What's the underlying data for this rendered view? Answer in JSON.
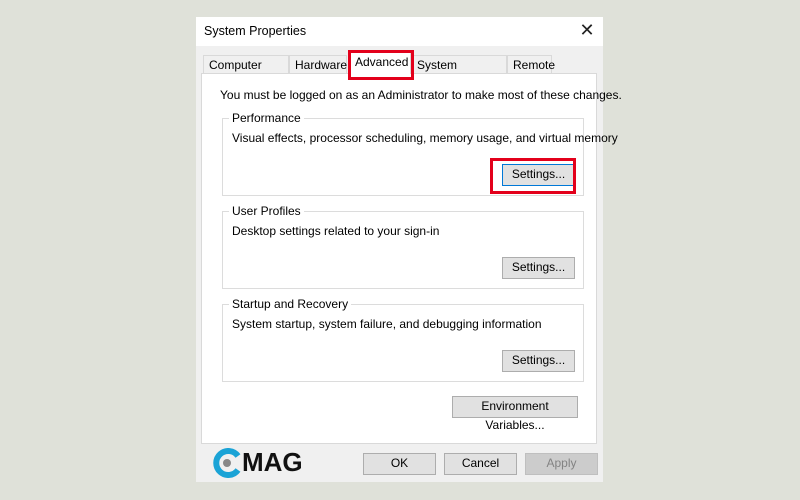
{
  "window": {
    "title": "System Properties",
    "close_icon": "close-icon"
  },
  "tabs": [
    {
      "label": "Computer Name"
    },
    {
      "label": "Hardware"
    },
    {
      "label": "Advanced",
      "active": true
    },
    {
      "label": "System Protection"
    },
    {
      "label": "Remote"
    }
  ],
  "notice": "You must be logged on as an Administrator to make most of these changes.",
  "groups": [
    {
      "title": "Performance",
      "description": "Visual effects, processor scheduling, memory usage, and virtual memory",
      "button": "Settings..."
    },
    {
      "title": "User Profiles",
      "description": "Desktop settings related to your sign-in",
      "button": "Settings..."
    },
    {
      "title": "Startup and Recovery",
      "description": "System startup, system failure, and debugging information",
      "button": "Settings..."
    }
  ],
  "env_button": "Environment Variables...",
  "footer": {
    "ok": "OK",
    "cancel": "Cancel",
    "apply": "Apply"
  },
  "logo": {
    "text": "MAG"
  },
  "colors": {
    "highlight": "#e3001b",
    "focus": "#0078d7",
    "logo_accent": "#1aa3d6"
  }
}
